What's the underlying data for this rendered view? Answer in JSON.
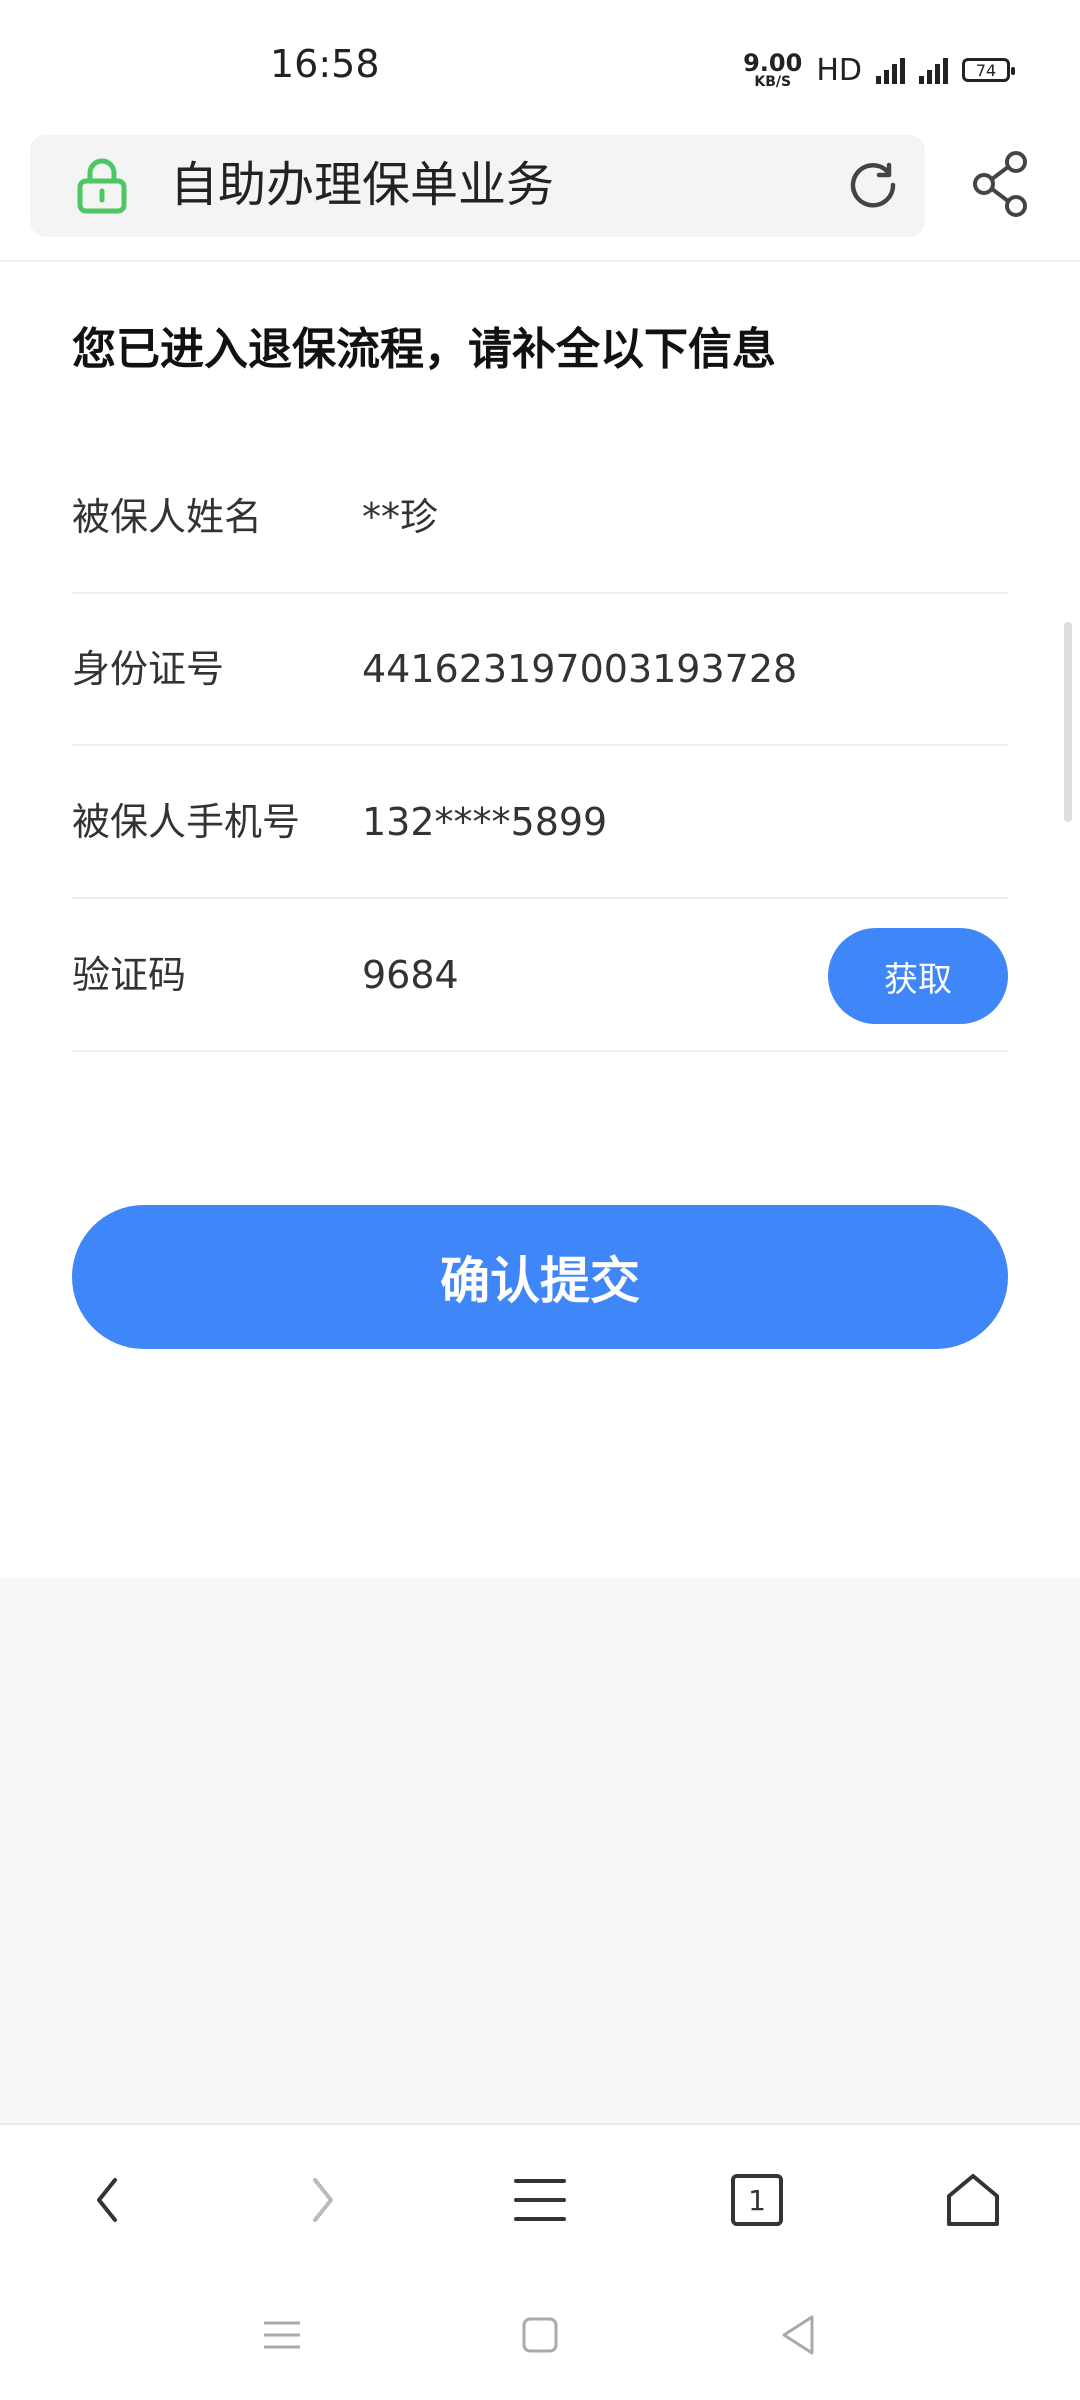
{
  "status_bar": {
    "time": "16:58",
    "net_speed_value": "9.00",
    "net_speed_unit": "KB/S",
    "hd_label": "HD",
    "battery_level": "74"
  },
  "address_bar": {
    "title": "自助办理保单业务"
  },
  "form": {
    "title": "您已进入退保流程，请补全以下信息",
    "rows": [
      {
        "label": "被保人姓名",
        "value": "**珍"
      },
      {
        "label": "身份证号",
        "value": "441623197003193728"
      },
      {
        "label": "被保人手机号",
        "value": "132****5899"
      },
      {
        "label": "验证码",
        "value": "9684"
      }
    ],
    "get_code_label": "获取",
    "submit_label": "确认提交"
  },
  "browser_toolbar": {
    "tab_count": "1"
  },
  "colors": {
    "accent": "#3f86f9",
    "lock_green": "#4cc764"
  }
}
